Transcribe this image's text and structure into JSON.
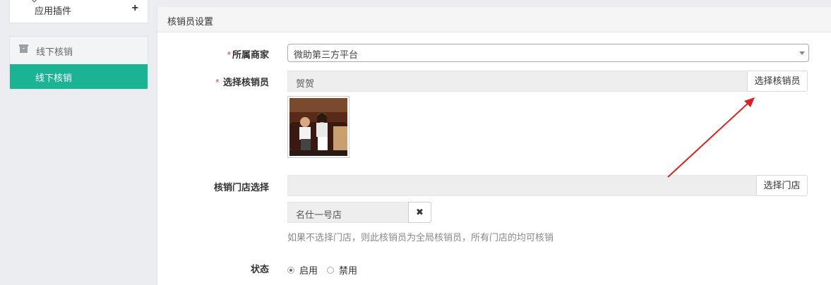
{
  "sidebar": {
    "plugins_label": "应用插件",
    "plus_symbol": "+",
    "group_title": "线下核销",
    "active_item": "线下核销"
  },
  "panel": {
    "title": "核销员设置"
  },
  "form": {
    "merchant": {
      "required_mark": "*",
      "label": "所属商家",
      "value": "微助第三方平台"
    },
    "clerk": {
      "required_mark": "*",
      "label": "选择核销员",
      "value": "贺贺",
      "button": "选择核销员"
    },
    "store": {
      "label": "核销门店选择",
      "value": "",
      "button": "选择门店",
      "selected_tag": "名仕一号店",
      "remove_symbol": "✖",
      "hint": "如果不选择门店，则此核销员为全局核销员，所有门店的均可核销"
    },
    "status": {
      "label": "状态",
      "options": [
        {
          "label": "启用",
          "checked": true
        },
        {
          "label": "禁用",
          "checked": false
        }
      ]
    }
  },
  "colors": {
    "accent": "#1ab394",
    "required": "#e4393c",
    "annotation_arrow": "#e02020"
  }
}
